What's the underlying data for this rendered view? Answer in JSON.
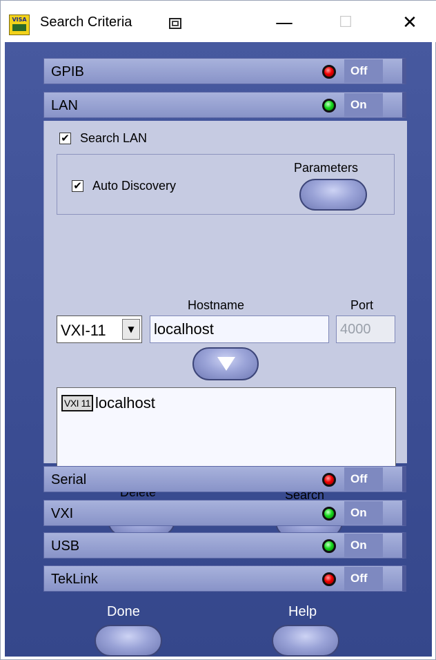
{
  "window": {
    "title": "Search Criteria",
    "app_icon_text": "VISA"
  },
  "interfaces": [
    {
      "id": "gpib",
      "label": "GPIB",
      "state": "Off",
      "on": false
    },
    {
      "id": "lan",
      "label": "LAN",
      "state": "On",
      "on": true
    },
    {
      "id": "serial",
      "label": "Serial",
      "state": "Off",
      "on": false
    },
    {
      "id": "vxi",
      "label": "VXI",
      "state": "On",
      "on": true
    },
    {
      "id": "usb",
      "label": "USB",
      "state": "On",
      "on": true
    },
    {
      "id": "teklink",
      "label": "TekLink",
      "state": "Off",
      "on": false
    }
  ],
  "lan": {
    "search_lan_label": "Search LAN",
    "search_lan_checked": true,
    "auto_discovery_label": "Auto Discovery",
    "auto_discovery_checked": true,
    "parameters_label": "Parameters",
    "hostname_label": "Hostname",
    "port_label": "Port",
    "protocol_selected": "VXI-11",
    "hostname_value": "localhost",
    "port_value": "4000",
    "list": [
      {
        "protocol": "VXI 11",
        "host": "localhost"
      }
    ],
    "delete_label": "Delete",
    "search_label": "Search"
  },
  "footer": {
    "done_label": "Done",
    "help_label": "Help"
  },
  "colors": {
    "panel_bg": "#3b4d93",
    "row_bg": "#8893c8",
    "led_off": "#e00000",
    "led_on": "#15d61a"
  }
}
